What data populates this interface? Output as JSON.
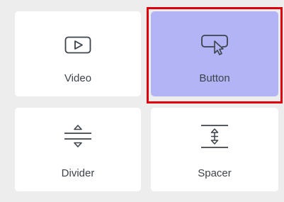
{
  "blocks": [
    {
      "id": "video",
      "label": "Video",
      "icon": "video-play-icon"
    },
    {
      "id": "button",
      "label": "Button",
      "icon": "button-cursor-icon",
      "selected": true
    },
    {
      "id": "divider",
      "label": "Divider",
      "icon": "divider-icon"
    },
    {
      "id": "spacer",
      "label": "Spacer",
      "icon": "spacer-icon"
    }
  ],
  "colors": {
    "tile_bg": "#ffffff",
    "selected_bg": "#b3b4f6",
    "selection_outline": "#e0000b",
    "panel_bg": "#ededee",
    "icon_stroke": "#3c434a"
  }
}
